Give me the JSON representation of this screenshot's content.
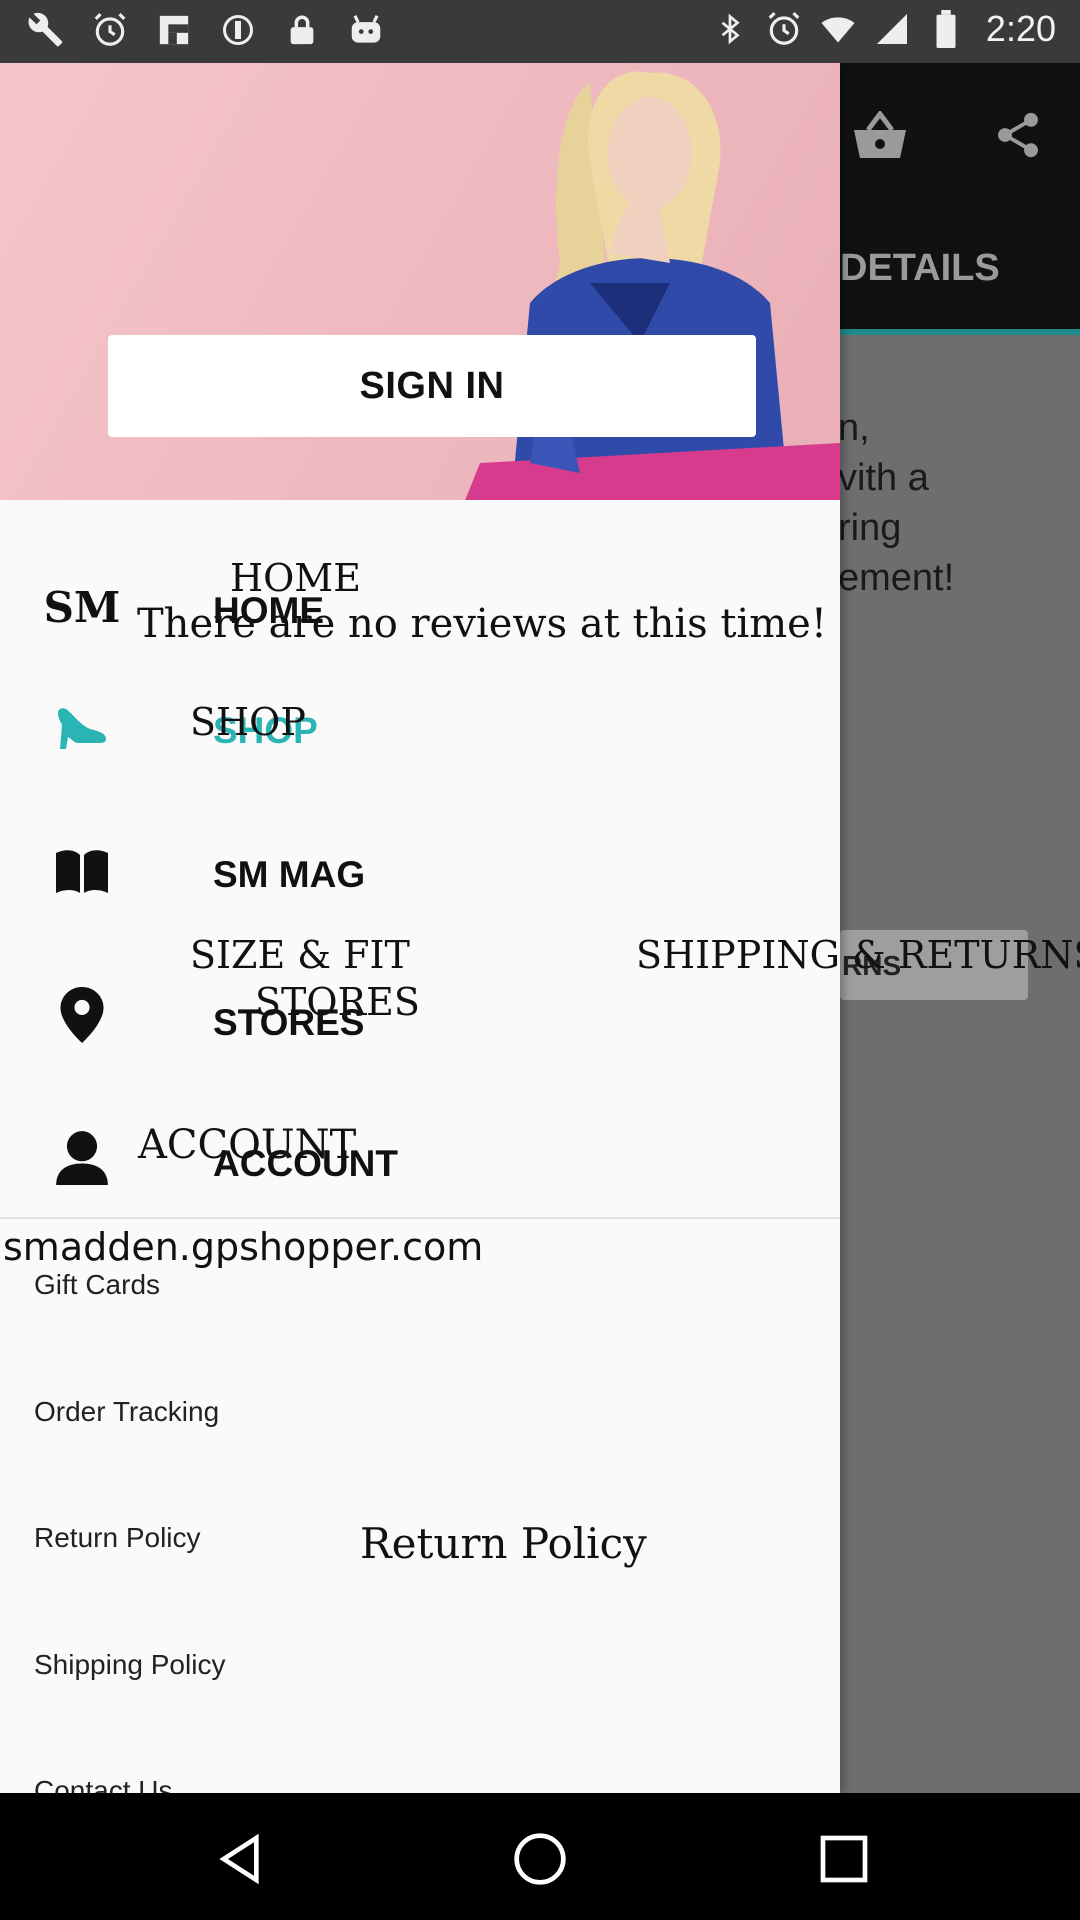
{
  "status_bar": {
    "time": "2:20",
    "left_icons": [
      "wrench-icon",
      "alarm-icon",
      "flipboard-icon",
      "settings-icon",
      "lock-icon",
      "android-icon"
    ],
    "right_icons": [
      "bluetooth-icon",
      "alarm-icon",
      "wifi-icon",
      "signal-icon",
      "battery-icon"
    ]
  },
  "background_screen": {
    "tab_label": "DETAILS",
    "description": "n,\nvith a\nring\nement!",
    "button_label": "RNS",
    "accent_color": "#1f8a8a"
  },
  "drawer": {
    "sign_in_label": "SIGN IN",
    "nav_items": [
      {
        "label": "HOME",
        "icon": "sm-logo-icon",
        "icon_text": "SM",
        "active": false
      },
      {
        "label": "SHOP",
        "icon": "high-heel-icon",
        "active": true
      },
      {
        "label": "SM MAG",
        "icon": "book-icon",
        "active": false
      },
      {
        "label": "STORES",
        "icon": "location-pin-icon",
        "active": false
      },
      {
        "label": "ACCOUNT",
        "icon": "person-icon",
        "active": false
      }
    ],
    "links": [
      "Gift Cards",
      "Order Tracking",
      "Return Policy",
      "Shipping Policy",
      "Contact Us"
    ],
    "active_color": "#2bb4b4"
  },
  "overlay_texts": {
    "home": "HOME",
    "no_reviews": "There are no reviews at this time!",
    "shop": "SHOP",
    "size_fit": "SIZE & FIT",
    "shipping_returns": "SHIPPING & RETURNS",
    "stores": "STORES",
    "account": "ACCOUNT",
    "domain": "smadden.gpshopper.com",
    "return_policy": "Return Policy"
  }
}
